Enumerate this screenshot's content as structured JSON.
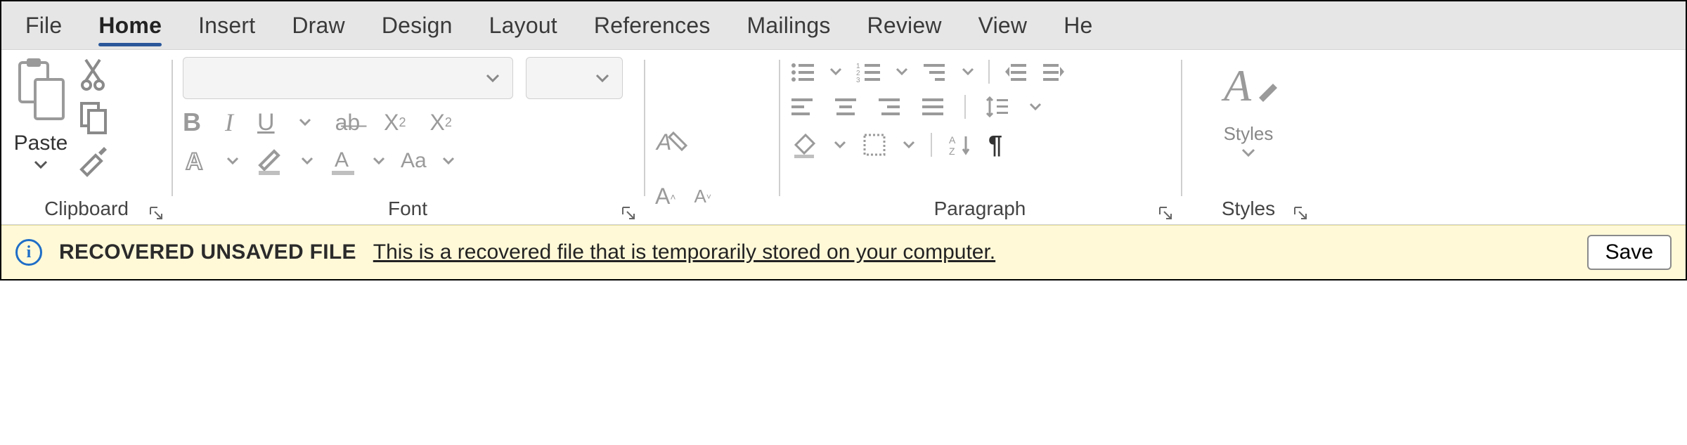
{
  "tabs": [
    {
      "label": "File",
      "active": false
    },
    {
      "label": "Home",
      "active": true
    },
    {
      "label": "Insert",
      "active": false
    },
    {
      "label": "Draw",
      "active": false
    },
    {
      "label": "Design",
      "active": false
    },
    {
      "label": "Layout",
      "active": false
    },
    {
      "label": "References",
      "active": false
    },
    {
      "label": "Mailings",
      "active": false
    },
    {
      "label": "Review",
      "active": false
    },
    {
      "label": "View",
      "active": false
    },
    {
      "label": "He",
      "active": false
    }
  ],
  "ribbon": {
    "clipboard": {
      "title": "Clipboard",
      "paste": "Paste"
    },
    "font": {
      "title": "Font"
    },
    "paragraph": {
      "title": "Paragraph"
    },
    "styles": {
      "title": "Styles",
      "styles": "Styles"
    }
  },
  "notification": {
    "title": "RECOVERED UNSAVED FILE",
    "message": "This is a recovered file that is temporarily stored on your computer.",
    "action": "Save"
  }
}
